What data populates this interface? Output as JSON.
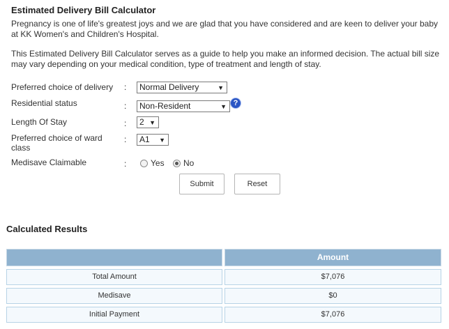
{
  "calculator": {
    "title": "Estimated Delivery Bill Calculator",
    "intro": "Pregnancy is one of life's greatest joys and we are glad that you have considered and are keen to deliver your baby at KK Women's and Children's Hospital.",
    "disclaimer": "This Estimated Delivery Bill Calculator serves as a guide to help you make an informed decision. The actual bill size may vary depending on your medical condition, type of treatment and length of stay."
  },
  "form": {
    "colon": ":",
    "delivery": {
      "label": "Preferred choice of delivery",
      "value": "Normal Delivery"
    },
    "residential": {
      "label": "Residential status",
      "value": "Non-Resident",
      "help_icon": "question-mark-icon"
    },
    "length": {
      "label": "Length Of Stay",
      "value": "2"
    },
    "ward": {
      "label_line1": "Preferred choice of ward",
      "label_line2": "class",
      "value": "A1"
    },
    "medisave": {
      "label": "Medisave Claimable",
      "yes": "Yes",
      "no": "No",
      "selected": "No"
    },
    "submit_label": "Submit",
    "reset_label": "Reset"
  },
  "results": {
    "title": "Calculated Results",
    "header_blank": "",
    "header_amount": "Amount",
    "rows": [
      {
        "label": "Total Amount",
        "amount": "$7,076"
      },
      {
        "label": "Medisave",
        "amount": "$0"
      },
      {
        "label": "Initial Payment",
        "amount": "$7,076"
      }
    ]
  },
  "colors": {
    "table_header": "#8fb2cf",
    "row_bg": "#f4f9fd",
    "help_icon": "#2a55c4"
  }
}
